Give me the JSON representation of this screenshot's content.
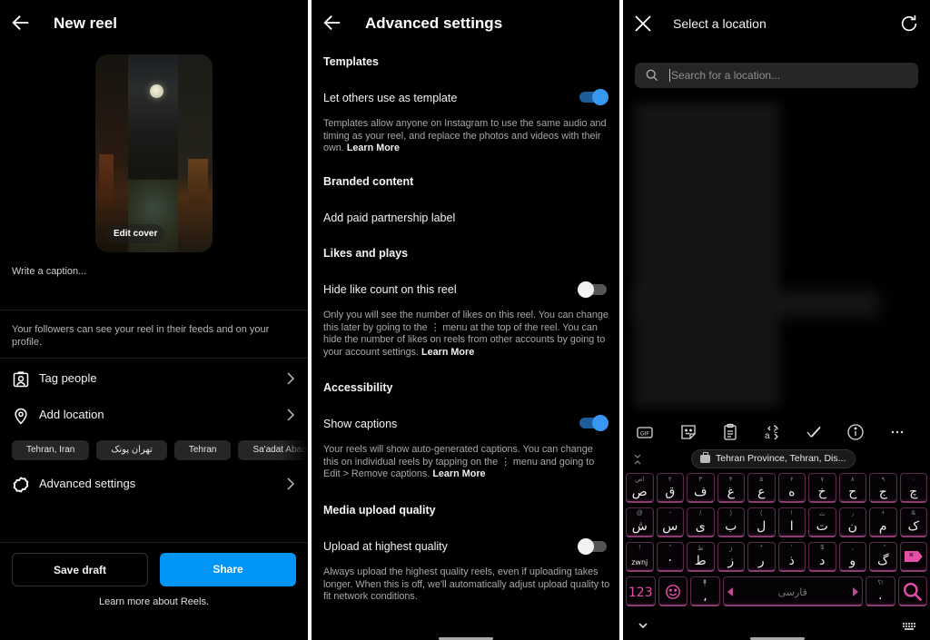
{
  "new_reel": {
    "title": "New reel",
    "back_icon": "arrow-left-icon",
    "cover_label": "Edit cover",
    "caption_placeholder": "Write a caption...",
    "followers_note": "Your followers can see your reel in their feeds and on your profile.",
    "rows": [
      {
        "label": "Tag people",
        "icon": "tag-person-icon"
      },
      {
        "label": "Add location",
        "icon": "location-pin-icon"
      },
      {
        "label": "Advanced settings",
        "icon": "gear-icon"
      }
    ],
    "location_chips": [
      "Tehran, Iran",
      "تهران پونک",
      "Tehran",
      "Sa'adat Abad"
    ],
    "save_draft_label": "Save draft",
    "share_label": "Share",
    "share_color": "#0095f6",
    "learn_more": "Learn more about Reels."
  },
  "advanced": {
    "title": "Advanced settings",
    "sections": [
      {
        "heading": "Templates"
      },
      {
        "heading": "Branded content"
      },
      {
        "heading": "Likes and plays"
      },
      {
        "heading": "Accessibility"
      },
      {
        "heading": "Media upload quality"
      }
    ],
    "settings": [
      {
        "label": "Let others use as template",
        "toggle": true,
        "desc": "Templates allow anyone on Instagram to use the same audio and timing as your reel, and replace the photos and videos with their own. ",
        "link": "Learn More"
      },
      {
        "label": "Add paid partnership label"
      },
      {
        "label": "Hide like count on this reel",
        "toggle": false,
        "desc": "Only you will see the number of likes on this reel. You can change this later by going to the ⋮ menu at the top of the reel. You can hide the number of likes on reels from other accounts by going to your account settings. ",
        "link": "Learn More"
      },
      {
        "label": "Show captions",
        "toggle": true,
        "desc": "Your reels will show auto-generated captions. You can change this on individual reels by tapping on the ⋮ menu and going to Edit > Remove captions. ",
        "link": "Learn More"
      },
      {
        "label": "Upload at highest quality",
        "toggle": false,
        "desc": "Always upload the highest quality reels, even if uploading takes longer. When this is off, we'll automatically adjust upload quality to fit network conditions."
      }
    ],
    "toggle_on_color": "#3897f0"
  },
  "location": {
    "title": "Select a location",
    "search_placeholder": "Search for a location...",
    "suggestion": "Tehran Province, Tehran, Dis...",
    "toolbar_icons": [
      "gif-icon",
      "sticker-icon",
      "clipboard-icon",
      "translate-icon",
      "spellcheck-icon",
      "info-icon",
      "more-icon"
    ],
    "keyboard": {
      "row1": [
        {
          "hint": "اص",
          "ch": "ص"
        },
        {
          "hint": "۲",
          "ch": "ق"
        },
        {
          "hint": "۳",
          "ch": "ف"
        },
        {
          "hint": "۴",
          "ch": "غ"
        },
        {
          "hint": "۵",
          "ch": "ع"
        },
        {
          "hint": "۶",
          "ch": "ه"
        },
        {
          "hint": "۷",
          "ch": "خ"
        },
        {
          "hint": "۸",
          "ch": "ح"
        },
        {
          "hint": "۹",
          "ch": "ج"
        },
        {
          "hint": "۰",
          "ch": "چ"
        }
      ],
      "row2": [
        {
          "hint": "@",
          "ch": "ش"
        },
        {
          "hint": "-",
          "ch": "س"
        },
        {
          "hint": "/",
          "ch": "ی"
        },
        {
          "hint": ")",
          "ch": "ب"
        },
        {
          "hint": "(",
          "ch": "ل"
        },
        {
          "hint": "!",
          "ch": "ا"
        },
        {
          "hint": "ث",
          "ch": "ت"
        },
        {
          "hint": "٫",
          "ch": "ن"
        },
        {
          "hint": "+",
          "ch": "م"
        },
        {
          "hint": "&",
          "ch": "ک"
        }
      ],
      "row3": [
        {
          "hint": "!",
          "ch": "zwnj"
        },
        {
          "hint": "\"",
          "ch": "·"
        },
        {
          "hint": "ظ",
          "ch": "ط"
        },
        {
          "hint": "ژ",
          "ch": "ز"
        },
        {
          "hint": "*",
          "ch": "ر"
        },
        {
          "hint": "'",
          "ch": "ذ"
        },
        {
          "hint": "$",
          "ch": "د"
        },
        {
          "hint": "،",
          "ch": "و"
        },
        {
          "hint": "ً",
          "ch": "گ"
        }
      ],
      "num_label": "123",
      "space_label": "فارسی",
      "period_hint": "؟!",
      "period": "."
    }
  }
}
